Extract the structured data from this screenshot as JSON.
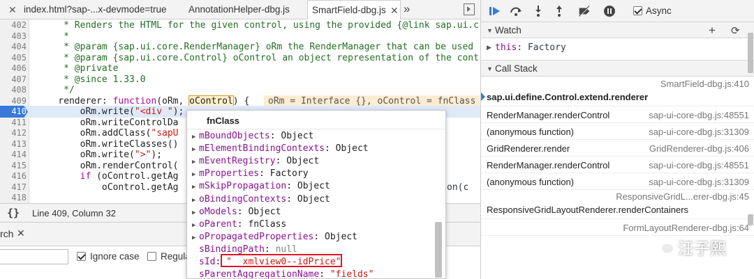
{
  "tabs": [
    {
      "label": "index.html?sap-...x-devmode=true",
      "closable": true
    },
    {
      "label": "AnnotationHelper-dbg.js",
      "closable": false
    },
    {
      "label": "SmartField-dbg.js",
      "closable": true,
      "active": true
    }
  ],
  "tab_more": "»",
  "code_lines": [
    {
      "n": "402",
      "text": "     * Renders the HTML for the given control, using the provided {@link sap.ui.c"
    },
    {
      "n": "403",
      "text": "     *"
    },
    {
      "n": "404",
      "text": "     * @param {sap.ui.core.RenderManager} oRm the RenderManager that can be used"
    },
    {
      "n": "405",
      "text": "     * @param {sap.ui.core.Control} oControl an object representation of the cont"
    },
    {
      "n": "406",
      "text": "     * @private"
    },
    {
      "n": "407",
      "text": "     * @since 1.33.0"
    },
    {
      "n": "408",
      "text": "     */"
    },
    {
      "n": "409",
      "pre": "    renderer: ",
      "kw": "function",
      "mid": "(oRm, ",
      "hl": "oControl",
      "post": ") {"
    },
    {
      "n": "410",
      "pre": "        oRm.write(",
      "str": "\"<div \"",
      "post": ");"
    },
    {
      "n": "411",
      "text": "        oRm.writeControlDa"
    },
    {
      "n": "412",
      "pre": "        oRm.addClass(",
      "str": "\"sapU",
      "post": ""
    },
    {
      "n": "413",
      "text": "        oRm.writeClasses()"
    },
    {
      "n": "414",
      "pre": "        oRm.write(",
      "str": "\">\"",
      "post": ");"
    },
    {
      "n": "415",
      "text": "        oRm.renderControl("
    },
    {
      "n": "416",
      "pre": "        ",
      "kw": "if",
      "mid": " (oControl.getAg",
      "post": ""
    },
    {
      "n": "417",
      "text": "            oControl.getAg"
    },
    {
      "n": "418",
      "text": ""
    }
  ],
  "line417_tail": "on(c",
  "inline_value": "oRm = Interface {}, oControl = fnClass",
  "status": {
    "position": "Line 409, Column 32",
    "braces": "{}"
  },
  "drawer": {
    "tab_name": "rch",
    "ignore_case_label": "Ignore case",
    "ignore_case_checked": true,
    "regex_label": "Regula",
    "regex_checked": false
  },
  "popup": {
    "title": "fnClass",
    "props": [
      {
        "expand": true,
        "name": "mBoundObjects",
        "value": "Object"
      },
      {
        "expand": true,
        "name": "mElementBindingContexts",
        "value": "Object"
      },
      {
        "expand": true,
        "name": "mEventRegistry",
        "value": "Object"
      },
      {
        "expand": true,
        "name": "mProperties",
        "value": "Factory"
      },
      {
        "expand": true,
        "name": "mSkipPropagation",
        "value": "Object"
      },
      {
        "expand": true,
        "name": "oBindingContexts",
        "value": "Object"
      },
      {
        "expand": true,
        "name": "oModels",
        "value": "Object"
      },
      {
        "expand": true,
        "name": "oParent",
        "value": "fnClass"
      },
      {
        "expand": true,
        "name": "oPropagatedProperties",
        "value": "Object"
      },
      {
        "expand": false,
        "name": "sBindingPath",
        "value": "null",
        "kind": "null"
      },
      {
        "expand": false,
        "name": "sId",
        "value": "\"__xmlview0--idPrice\"",
        "kind": "str"
      },
      {
        "expand": false,
        "name": "sParentAggregationName",
        "value": "\"fields\"",
        "kind": "str"
      }
    ]
  },
  "debugger": {
    "async_label": "Async",
    "async_checked": true,
    "watch_label": "Watch",
    "watch_add": "+",
    "watch_refresh": "⟳",
    "watch_item": {
      "name": "this",
      "value": "Factory"
    },
    "callstack_label": "Call Stack",
    "frames": [
      {
        "fn": "sap.ui.define.Control.extend.renderer",
        "loc": "SmartField-dbg.js:410",
        "selected": true,
        "two_line": true
      },
      {
        "fn": "RenderManager.renderControl",
        "loc": "sap-ui-core-dbg.js:48551"
      },
      {
        "fn": "(anonymous function)",
        "loc": "sap-ui-core-dbg.js:31309"
      },
      {
        "fn": "GridRenderer.render",
        "loc": "GridRenderer-dbg.js:406"
      },
      {
        "fn": "RenderManager.renderControl",
        "loc": "sap-ui-core-dbg.js:48551"
      },
      {
        "fn": "(anonymous function)",
        "loc": "sap-ui-core-dbg.js:31309"
      },
      {
        "fn": "ResponsiveGridLayoutRenderer.renderContainers",
        "loc": "ResponsiveGridL...erer-dbg.js:45",
        "two_line": true
      },
      {
        "fn": "",
        "loc": "FormLayoutRenderer-dbg.js:64"
      }
    ]
  },
  "watermark": {
    "text": "汪子熙"
  },
  "colors": {
    "accent": "#3879d9",
    "exec_line": "#dfe9f8",
    "highlight_box": "#e0141e"
  }
}
